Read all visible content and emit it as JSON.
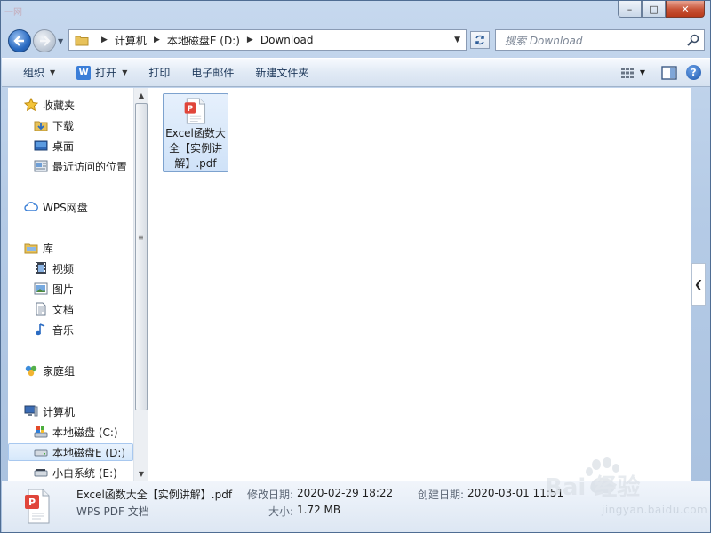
{
  "window": {
    "title_remnant": "一网",
    "minimize": "–",
    "maximize": "□",
    "close": "✕"
  },
  "address_bar": {
    "crumbs": [
      "计算机",
      "本地磁盘E (D:)",
      "Download"
    ],
    "search_placeholder": "搜索 Download"
  },
  "toolbar": {
    "organize": "组织",
    "open": "打开",
    "print": "打印",
    "email": "电子邮件",
    "new_folder": "新建文件夹"
  },
  "nav": {
    "favorites": "收藏夹",
    "downloads": "下载",
    "desktop": "桌面",
    "recent": "最近访问的位置",
    "wps": "WPS网盘",
    "libraries": "库",
    "videos": "视频",
    "pictures": "图片",
    "documents": "文档",
    "music": "音乐",
    "homegroup": "家庭组",
    "computer": "计算机",
    "drive_c": "本地磁盘 (C:)",
    "drive_d": "本地磁盘E (D:)",
    "drive_e": "小白系统 (E:)"
  },
  "files": [
    {
      "name": "Excel函数大全【实例讲解】.pdf",
      "icon": "wps-pdf-icon",
      "selected": true
    }
  ],
  "details": {
    "name": "Excel函数大全【实例讲解】.pdf",
    "type": "WPS PDF 文档",
    "modified_label": "修改日期:",
    "modified_value": "2020-02-29 18:22",
    "size_label": "大小:",
    "size_value": "1.72 MB",
    "created_label": "创建日期:",
    "created_value": "2020-03-01 11:51"
  },
  "watermark": {
    "text": "jingyan.baidu.com",
    "brand": "Bai 经验"
  },
  "colors": {
    "accent": "#3b7ed8",
    "pdf_red": "#e0453a",
    "selection": "#cfe2f8"
  }
}
